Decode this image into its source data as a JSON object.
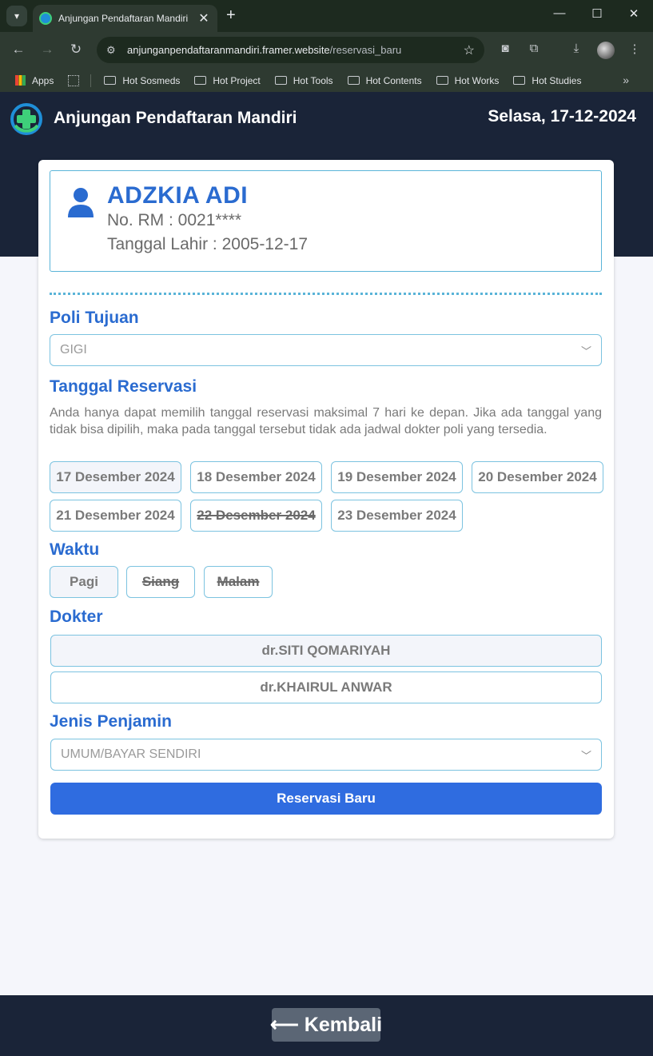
{
  "browser": {
    "tab_title": "Anjungan Pendaftaran Mandiri",
    "url_host": "anjunganpendaftaranmandiri.framer.website",
    "url_path": "/reservasi_baru",
    "bookmarks": [
      "Apps",
      "Hot Sosmeds",
      "Hot Project",
      "Hot Tools",
      "Hot Contents",
      "Hot Works",
      "Hot Studies"
    ]
  },
  "header": {
    "title": "Anjungan Pendaftaran Mandiri",
    "date": "Selasa, 17-12-2024"
  },
  "patient": {
    "name": "ADZKIA ADI",
    "rm": "No. RM : 0021****",
    "dob": "Tanggal Lahir : 2005-12-17"
  },
  "form": {
    "poli_label": "Poli Tujuan",
    "poli_value": "GIGI",
    "tanggal_label": "Tanggal Reservasi",
    "tanggal_note": "Anda hanya dapat memilih tanggal reservasi maksimal 7 hari ke depan. Jika ada tanggal yang tidak bisa dipilih, maka pada tanggal tersebut tidak ada jadwal dokter poli yang tersedia.",
    "dates": [
      {
        "label": "17 Desember 2024",
        "state": "selected"
      },
      {
        "label": "18 Desember 2024",
        "state": "available"
      },
      {
        "label": "19 Desember 2024",
        "state": "available"
      },
      {
        "label": "20 Desember 2024",
        "state": "available"
      },
      {
        "label": "21 Desember 2024",
        "state": "available"
      },
      {
        "label": "22 Desember 2024",
        "state": "disabled"
      },
      {
        "label": "23 Desember 2024",
        "state": "available"
      }
    ],
    "waktu_label": "Waktu",
    "times": [
      {
        "label": "Pagi",
        "state": "selected"
      },
      {
        "label": "Siang",
        "state": "disabled"
      },
      {
        "label": "Malam",
        "state": "disabled"
      }
    ],
    "dokter_label": "Dokter",
    "doctors": [
      {
        "label": "dr.SITI QOMARIYAH",
        "state": "selected"
      },
      {
        "label": "dr.KHAIRUL ANWAR",
        "state": "available"
      }
    ],
    "penjamin_label": "Jenis Penjamin",
    "penjamin_value": "UMUM/BAYAR SENDIRI",
    "submit_label": "Reservasi Baru"
  },
  "footer": {
    "back_label": "⟵ Kembali"
  },
  "colors": {
    "accent": "#2a6bd0",
    "header_bg": "#1a2438",
    "border": "#7cc3e0",
    "primary_button": "#2f6ce0"
  }
}
